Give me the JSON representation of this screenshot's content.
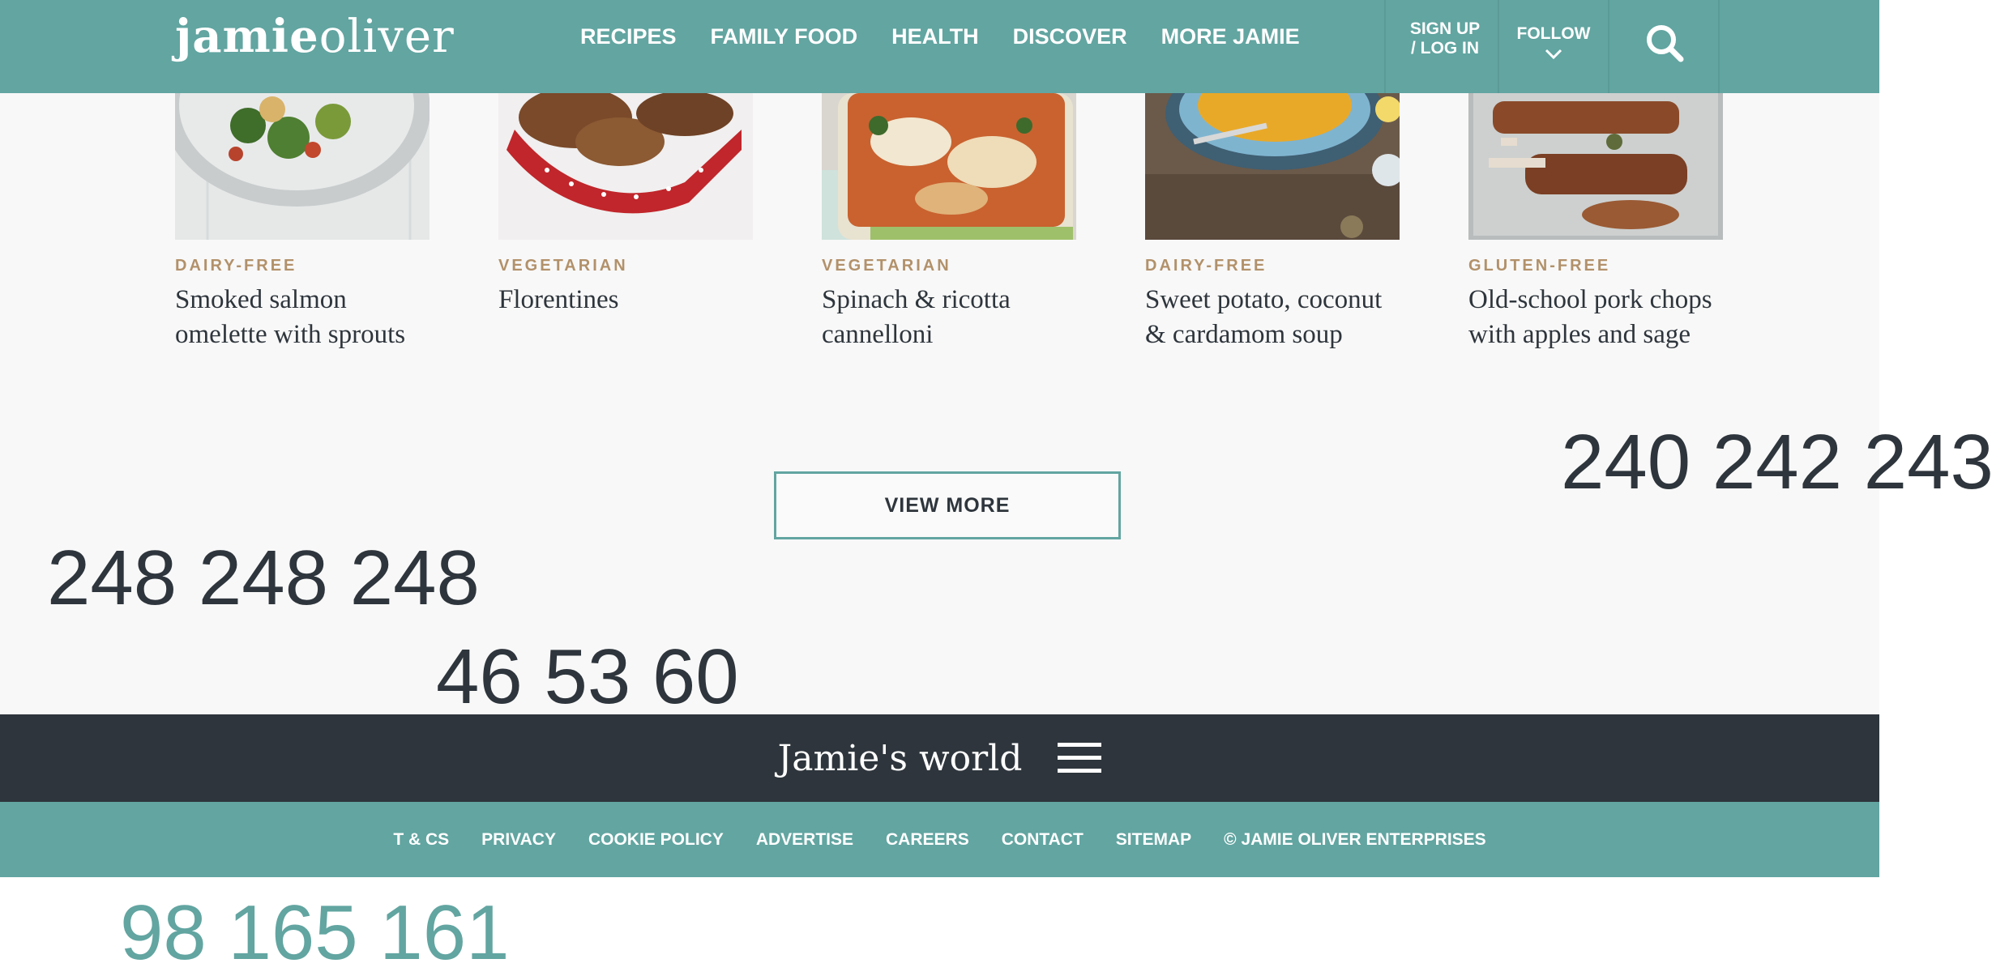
{
  "header": {
    "logo_bold": "jamie",
    "logo_light": "oliver",
    "nav": [
      "RECIPES",
      "FAMILY FOOD",
      "HEALTH",
      "DISCOVER",
      "MORE JAMIE"
    ],
    "signup_line1": "SIGN UP",
    "signup_line2": "/ LOG IN",
    "follow": "FOLLOW",
    "search_icon": "search-icon"
  },
  "recipes": [
    {
      "tag": "DAIRY-FREE",
      "title": "Smoked salmon omelette with sprouts"
    },
    {
      "tag": "VEGETARIAN",
      "title": "Florentines"
    },
    {
      "tag": "VEGETARIAN",
      "title": "Spinach & ricotta cannelloni"
    },
    {
      "tag": "DAIRY-FREE",
      "title": "Sweet potato, coconut & cardamom soup"
    },
    {
      "tag": "GLUTEN-FREE",
      "title": "Old-school pork chops with apples and sage"
    }
  ],
  "view_more": "VIEW MORE",
  "color_notes": {
    "a": "240 242 243",
    "b": "248 248 248",
    "c": "46 53 60",
    "d": "98 165 161"
  },
  "world": {
    "title": "Jamie's world",
    "menu_icon": "hamburger-menu-icon"
  },
  "footer_links": [
    "T & CS",
    "PRIVACY",
    "COOKIE POLICY",
    "ADVERTISE",
    "CAREERS",
    "CONTACT",
    "SITEMAP",
    "© JAMIE OLIVER ENTERPRISES"
  ],
  "colors": {
    "teal": "#62a5a1",
    "charcoal": "#2e353c",
    "page_bg": "#f8f8f8",
    "tag": "#b2916a"
  }
}
